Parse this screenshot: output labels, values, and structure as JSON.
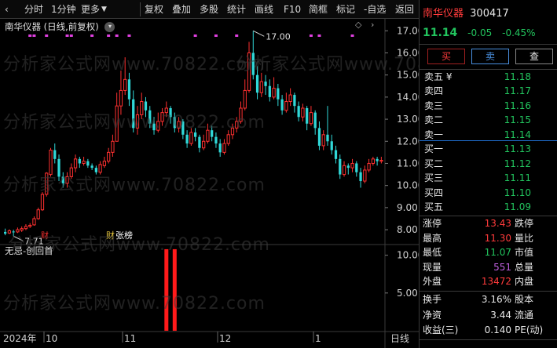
{
  "toolbar": {
    "left_items": [
      "分时",
      "1分钟",
      "更多"
    ],
    "right_items": [
      "复权",
      "叠加",
      "多股",
      "统计",
      "画线",
      "F10",
      "简框",
      "标记",
      "-自选",
      "返回"
    ]
  },
  "chart": {
    "title": "南华仪器 (日线,前复权)",
    "watermark": "分析家公式网www.70822.com",
    "price_axis": [
      "17.00",
      "16.00",
      "15.00",
      "14.00",
      "13.00",
      "12.00",
      "11.00",
      "10.00",
      "9.00",
      "8.00"
    ],
    "high_label": "17.00",
    "low_label": "7.71",
    "event_labels": [
      "财",
      "张榜"
    ],
    "indicator_title": "无忌-创回首",
    "indicator_axis": [
      "10.00",
      "5.00"
    ],
    "date_axis": [
      "2024年",
      "10",
      "11",
      "12",
      "1"
    ],
    "date_right": "日线"
  },
  "chart_data": {
    "type": "candlestick",
    "ylim": [
      7.4,
      17.4
    ],
    "price_ticks": [
      8,
      9,
      10,
      11,
      12,
      13,
      14,
      15,
      16,
      17
    ],
    "candles": [
      [
        7.9,
        7.82,
        8.05,
        7.75
      ],
      [
        7.85,
        7.95,
        8.02,
        7.8
      ],
      [
        7.92,
        7.88,
        8.0,
        7.71
      ],
      [
        7.9,
        8.0,
        8.1,
        7.85
      ],
      [
        7.98,
        8.05,
        8.15,
        7.9
      ],
      [
        8.05,
        8.15,
        8.25,
        7.98
      ],
      [
        8.15,
        8.2,
        8.3,
        8.08
      ],
      [
        8.22,
        8.5,
        8.6,
        8.18
      ],
      [
        8.5,
        8.9,
        9.0,
        8.45
      ],
      [
        8.9,
        9.6,
        9.7,
        8.85
      ],
      [
        9.6,
        10.56,
        10.6,
        9.5
      ],
      [
        10.5,
        11.6,
        11.7,
        10.4
      ],
      [
        11.6,
        11.2,
        11.9,
        11.0
      ],
      [
        11.2,
        10.4,
        11.4,
        10.2
      ],
      [
        10.4,
        10.1,
        10.6,
        9.9
      ],
      [
        10.1,
        10.4,
        10.6,
        9.9
      ],
      [
        10.4,
        10.8,
        11.0,
        10.3
      ],
      [
        10.8,
        11.2,
        11.4,
        10.6
      ],
      [
        11.2,
        11.0,
        11.3,
        10.8
      ],
      [
        11.0,
        11.1,
        11.3,
        10.9
      ],
      [
        11.1,
        10.9,
        11.2,
        10.8
      ],
      [
        10.9,
        10.8,
        11.0,
        10.7
      ],
      [
        10.8,
        10.6,
        10.9,
        10.5
      ],
      [
        10.6,
        10.95,
        11.1,
        10.5
      ],
      [
        10.9,
        11.1,
        11.3,
        10.8
      ],
      [
        11.1,
        11.5,
        11.7,
        11.0
      ],
      [
        11.5,
        12.0,
        12.3,
        11.3
      ],
      [
        12.0,
        13.6,
        14.2,
        12.0
      ],
      [
        13.6,
        14.3,
        15.2,
        13.2
      ],
      [
        14.3,
        14.8,
        15.8,
        14.1
      ],
      [
        14.8,
        13.9,
        15.1,
        13.6
      ],
      [
        13.9,
        12.6,
        14.3,
        12.4
      ],
      [
        12.6,
        13.2,
        13.6,
        12.3
      ],
      [
        13.2,
        13.8,
        14.2,
        13.0
      ],
      [
        13.8,
        13.4,
        14.0,
        13.1
      ],
      [
        13.4,
        12.8,
        13.6,
        12.6
      ],
      [
        12.8,
        12.5,
        13.1,
        12.3
      ],
      [
        12.5,
        12.9,
        13.3,
        12.4
      ],
      [
        12.9,
        13.3,
        13.5,
        12.7
      ],
      [
        13.3,
        13.5,
        13.8,
        13.1
      ],
      [
        13.5,
        13.1,
        13.6,
        12.8
      ],
      [
        13.1,
        12.6,
        13.3,
        12.4
      ],
      [
        12.6,
        12.9,
        13.1,
        12.4
      ],
      [
        12.9,
        12.3,
        13.0,
        12.1
      ],
      [
        12.3,
        11.9,
        12.5,
        11.7
      ],
      [
        11.9,
        12.4,
        12.6,
        11.8
      ],
      [
        12.4,
        12.2,
        12.6,
        12.0
      ],
      [
        12.2,
        11.7,
        12.3,
        11.5
      ],
      [
        11.7,
        12.0,
        12.3,
        11.6
      ],
      [
        12.0,
        12.5,
        12.8,
        11.9
      ],
      [
        12.5,
        12.2,
        12.7,
        12.0
      ],
      [
        12.2,
        11.9,
        12.4,
        11.7
      ],
      [
        11.9,
        11.5,
        12.1,
        11.3
      ],
      [
        11.5,
        11.9,
        12.1,
        11.4
      ],
      [
        11.9,
        12.3,
        12.5,
        11.8
      ],
      [
        12.3,
        12.6,
        12.8,
        12.1
      ],
      [
        12.6,
        12.9,
        13.1,
        12.4
      ],
      [
        12.9,
        13.5,
        13.8,
        12.8
      ],
      [
        13.5,
        14.3,
        14.8,
        13.4
      ],
      [
        14.3,
        16.0,
        16.5,
        14.2
      ],
      [
        16.0,
        15.0,
        17.0,
        14.8
      ],
      [
        15.0,
        14.2,
        15.4,
        13.9
      ],
      [
        14.2,
        14.7,
        15.1,
        14.0
      ],
      [
        14.7,
        14.5,
        15.0,
        14.1
      ],
      [
        14.5,
        14.0,
        14.8,
        13.8
      ],
      [
        14.0,
        14.4,
        14.9,
        13.9
      ],
      [
        14.4,
        13.9,
        14.6,
        13.6
      ],
      [
        13.9,
        13.4,
        14.1,
        13.2
      ],
      [
        13.4,
        13.8,
        14.2,
        13.3
      ],
      [
        13.8,
        14.1,
        14.4,
        13.6
      ],
      [
        14.1,
        13.6,
        14.2,
        13.3
      ],
      [
        13.6,
        13.1,
        13.8,
        12.9
      ],
      [
        13.1,
        13.5,
        13.7,
        12.9
      ],
      [
        13.5,
        12.8,
        13.6,
        12.5
      ],
      [
        12.8,
        13.3,
        13.6,
        12.7
      ],
      [
        13.3,
        12.6,
        13.4,
        12.3
      ],
      [
        12.6,
        11.8,
        12.9,
        11.6
      ],
      [
        11.8,
        12.3,
        12.5,
        11.6
      ],
      [
        12.3,
        12.0,
        13.6,
        11.8
      ],
      [
        12.0,
        11.6,
        12.3,
        11.4
      ],
      [
        11.6,
        11.2,
        11.8,
        11.0
      ],
      [
        11.2,
        10.5,
        11.4,
        10.3
      ],
      [
        10.5,
        10.9,
        11.1,
        10.4
      ],
      [
        10.9,
        10.8,
        11.0,
        10.5
      ],
      [
        10.8,
        11.0,
        11.2,
        10.6
      ],
      [
        11.0,
        10.6,
        11.1,
        10.4
      ],
      [
        10.6,
        10.2,
        10.8,
        9.9
      ],
      [
        10.2,
        10.7,
        10.9,
        10.1
      ],
      [
        10.7,
        11.0,
        11.2,
        10.6
      ],
      [
        11.0,
        11.2,
        11.3,
        10.9
      ],
      [
        11.2,
        11.1,
        11.3,
        10.9
      ],
      [
        11.1,
        11.14,
        11.3,
        11.0
      ]
    ],
    "markers_top": [
      6,
      7,
      10,
      15,
      16,
      21,
      25,
      27,
      30,
      46,
      51,
      56,
      74,
      76,
      84
    ],
    "indicator": {
      "ylim": [
        0,
        11
      ],
      "ticks": [
        5,
        10
      ],
      "bars": [
        {
          "x": 39,
          "value": 10.8
        },
        {
          "x": 41,
          "value": 10.8
        }
      ]
    }
  },
  "quote": {
    "name": "南华仪器",
    "code": "300417",
    "price": "11.14",
    "change": "-0.05",
    "change_pct": "-0.45%",
    "buttons": [
      "买",
      "卖",
      "查"
    ],
    "sell": [
      {
        "label": "卖五 ¥",
        "price": "11.18"
      },
      {
        "label": "卖四",
        "price": "11.17"
      },
      {
        "label": "卖三",
        "price": "11.16"
      },
      {
        "label": "卖二",
        "price": "11.15"
      },
      {
        "label": "卖一",
        "price": "11.14"
      }
    ],
    "buy": [
      {
        "label": "买一",
        "price": "11.13"
      },
      {
        "label": "买二",
        "price": "11.12"
      },
      {
        "label": "买三",
        "price": "11.11"
      },
      {
        "label": "买四",
        "price": "11.10"
      },
      {
        "label": "买五",
        "price": "11.09"
      }
    ],
    "stats": [
      {
        "l1": "涨停",
        "v1": "13.43",
        "l2": "跌停",
        "c": "red"
      },
      {
        "l1": "最高",
        "v1": "11.30",
        "l2": "量比",
        "c": "red"
      },
      {
        "l1": "最低",
        "v1": "11.07",
        "l2": "市值",
        "c": "green"
      },
      {
        "l1": "现量",
        "v1": "551",
        "l2": "总量",
        "c": "purple"
      },
      {
        "l1": "外盘",
        "v1": "13472",
        "l2": "内盘",
        "c": "red"
      }
    ],
    "stats2": [
      {
        "l1": "换手",
        "v1": "3.16%",
        "l2": "股本"
      },
      {
        "l1": "净资",
        "v1": "3.44",
        "l2": "流通"
      },
      {
        "l1": "收益(三)",
        "v1": "0.140",
        "l2": "PE(动)"
      }
    ]
  }
}
